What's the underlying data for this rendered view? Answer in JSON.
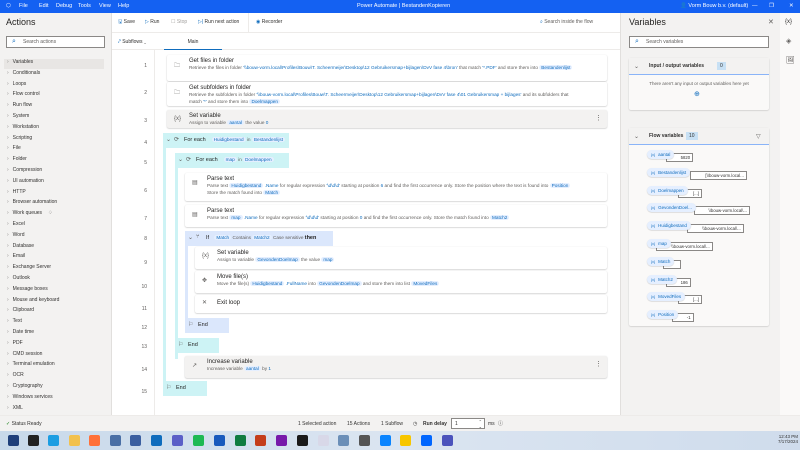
{
  "titlebar": {
    "menu": [
      "File",
      "Edit",
      "Debug",
      "Tools",
      "View",
      "Help"
    ],
    "title": "Power Automate | BestandenKopieren",
    "account": "Vorm Bouw b.v. (default)"
  },
  "actions": {
    "heading": "Actions",
    "search_placeholder": "Search actions",
    "items": [
      "Variables",
      "Conditionals",
      "Loops",
      "Flow control",
      "Run flow",
      "System",
      "Workstation",
      "Scripting",
      "File",
      "Folder",
      "Compression",
      "UI automation",
      "HTTP",
      "Browser automation",
      "Work queues",
      "Excel",
      "Word",
      "Database",
      "Email",
      "Exchange Server",
      "Outlook",
      "Message boxes",
      "Mouse and keyboard",
      "Clipboard",
      "Text",
      "Date time",
      "PDF",
      "CMD session",
      "Terminal emulation",
      "OCR",
      "Cryptography",
      "Windows services",
      "XML"
    ]
  },
  "toolbar": {
    "save": "Save",
    "run": "Run",
    "stop": "Stop",
    "run_next": "Run next action",
    "recorder": "Recorder",
    "search_flow": "Search inside the flow"
  },
  "tabs": {
    "subflows": "Subflows",
    "main": "Main"
  },
  "steps": [
    {
      "n": "1",
      "title": "Get files in folder",
      "icon": "folder-files-icon",
      "desc": [
        [
          "Retrieve the files in folder ",
          ""
        ],
        [
          "'\\\\bouw-vorm.local\\Profiles\\Bouw\\T. Scheermeijer\\Desktop\\12 Gebruikersmap+bijlagen\\DvV fase 4\\bron'",
          "lit"
        ],
        [
          " that match ",
          ""
        ],
        [
          "'*.PDF'",
          "lit"
        ],
        [
          " and store them into ",
          ""
        ],
        [
          "Bestandenlijst",
          "tok"
        ]
      ]
    },
    {
      "n": "2",
      "title": "Get subfolders in folder",
      "icon": "folder-icon",
      "desc": [
        [
          "Retrieve the subfolders in folder ",
          ""
        ],
        [
          "'\\\\bouw-vorm.local\\Profiles\\Bouw\\T. Scheermeijer\\Desktop\\12 Gebruikersmap+bijlagen\\DvV fase 4\\01 Gebruikersmap + bijlages'",
          "lit"
        ],
        [
          " and its subfolders that",
          ""
        ]
      ],
      "desc2": [
        [
          "match ",
          ""
        ],
        [
          "'*'",
          "lit"
        ],
        [
          " and store them into ",
          ""
        ],
        [
          "Doelmappen",
          "tok"
        ]
      ]
    },
    {
      "n": "3",
      "title": "Set variable",
      "icon": "variable-icon",
      "desc": [
        [
          "Assign to variable ",
          ""
        ],
        [
          "aantal",
          "tok"
        ],
        [
          " the value ",
          ""
        ],
        [
          "0",
          "lit"
        ]
      ]
    },
    {
      "n": "4",
      "title": "For each",
      "icon": "loop-icon",
      "head": [
        [
          "Huidigbestand",
          "tok"
        ],
        [
          " in ",
          ""
        ],
        [
          "Bestandenlijst",
          "tok"
        ]
      ]
    },
    {
      "n": "5",
      "title": "For each",
      "icon": "loop-icon",
      "head": [
        [
          "map",
          "tok"
        ],
        [
          " in ",
          ""
        ],
        [
          "Doelmappen",
          "tok"
        ]
      ]
    },
    {
      "n": "6",
      "title": "Parse text",
      "icon": "parse-text-icon",
      "desc": [
        [
          "Parse text ",
          ""
        ],
        [
          "Huidigbestand",
          "tok"
        ],
        [
          " .Name",
          "lit"
        ],
        [
          " for regular expression ",
          ""
        ],
        [
          "'\\d\\d\\d'",
          "lit"
        ],
        [
          " starting at position ",
          ""
        ],
        [
          "6",
          "lit"
        ],
        [
          " and find the first occurrence only. Store the position where the text is found into ",
          ""
        ],
        [
          "Position",
          "tok"
        ]
      ],
      "desc2": [
        [
          "Store the match found into ",
          ""
        ],
        [
          "Match",
          "tok"
        ]
      ]
    },
    {
      "n": "7",
      "title": "Parse text",
      "icon": "parse-text-icon",
      "desc": [
        [
          "Parse text ",
          ""
        ],
        [
          "map",
          "tok"
        ],
        [
          " .Name",
          "lit"
        ],
        [
          " for regular expression ",
          ""
        ],
        [
          "'\\d\\d\\d'",
          "lit"
        ],
        [
          " starting at position ",
          ""
        ],
        [
          "0",
          "lit"
        ],
        [
          " and find the first occurrence only. Store the match found into ",
          ""
        ],
        [
          "Match2",
          "tok"
        ]
      ]
    },
    {
      "n": "8",
      "title": "If",
      "icon": "if-icon",
      "head": [
        [
          "Match",
          "tok"
        ],
        [
          " Contains ",
          ""
        ],
        [
          "Match2",
          "tok"
        ],
        [
          " Case sensitive ",
          ""
        ],
        [
          "then",
          "b"
        ]
      ]
    },
    {
      "n": "9",
      "title": "Set variable",
      "icon": "variable-icon",
      "desc": [
        [
          "Assign to variable ",
          ""
        ],
        [
          "GevondenDoelmap",
          "tok"
        ],
        [
          " the value ",
          ""
        ],
        [
          "map",
          "tok"
        ]
      ]
    },
    {
      "n": "10",
      "title": "Move file(s)",
      "icon": "move-icon",
      "desc": [
        [
          "Move the file(s) ",
          ""
        ],
        [
          "Huidigbestand",
          "tok"
        ],
        [
          " .FullName",
          "lit"
        ],
        [
          " into ",
          ""
        ],
        [
          "GevondenDoelmap",
          "tok"
        ],
        [
          " and store them into list ",
          ""
        ],
        [
          "MovedFiles",
          "tok"
        ]
      ]
    },
    {
      "n": "11",
      "title": "Exit loop",
      "icon": "exit-icon"
    },
    {
      "n": "12",
      "title": "End",
      "icon": "flag-icon"
    },
    {
      "n": "13",
      "title": "End",
      "icon": "flag-icon"
    },
    {
      "n": "14",
      "title": "Increase variable",
      "icon": "increase-icon",
      "desc": [
        [
          "Increase variable ",
          ""
        ],
        [
          "aantal",
          "tok"
        ],
        [
          " by ",
          ""
        ],
        [
          "1",
          "lit"
        ]
      ]
    },
    {
      "n": "15",
      "title": "End",
      "icon": "flag-icon"
    }
  ],
  "variables": {
    "heading": "Variables",
    "search_placeholder": "Search variables",
    "io_label": "Input / output variables",
    "io_count": "0",
    "io_empty": "There aren't any input or output variables here yet",
    "flow_label": "Flow variables",
    "flow_count": "10",
    "list": [
      {
        "name": "aantal",
        "value": "5820"
      },
      {
        "name": "Bestandenlijst",
        "value": "[\\\\bouw-vorm.local..."
      },
      {
        "name": "Doelmappen",
        "value": "[...]"
      },
      {
        "name": "GevondenDoel...",
        "value": "\\\\bouw-vorm.local\\..."
      },
      {
        "name": "Huidigbestand",
        "value": "\\\\bouw-vorm.local\\..."
      },
      {
        "name": "map",
        "value": "\\\\bouw-vorm.local\\..."
      },
      {
        "name": "Match",
        "value": ""
      },
      {
        "name": "Match2",
        "value": "186"
      },
      {
        "name": "MovedFiles",
        "value": "[...]"
      },
      {
        "name": "Position",
        "value": "-1"
      }
    ]
  },
  "status": {
    "ready": "Status Ready",
    "selected": "1 Selected action",
    "actions": "15 Actions",
    "subflows": "1 Subflow",
    "run_delay_label": "Run delay",
    "run_delay_value": "1",
    "unit": "ms"
  },
  "taskbar": {
    "time": "12:43 PM",
    "date": "7/17/2024"
  },
  "colors": {
    "accent": "#1461f2",
    "loop": "#cdf3f5",
    "if": "#dbe7fc",
    "token": "#0f6cbd"
  }
}
